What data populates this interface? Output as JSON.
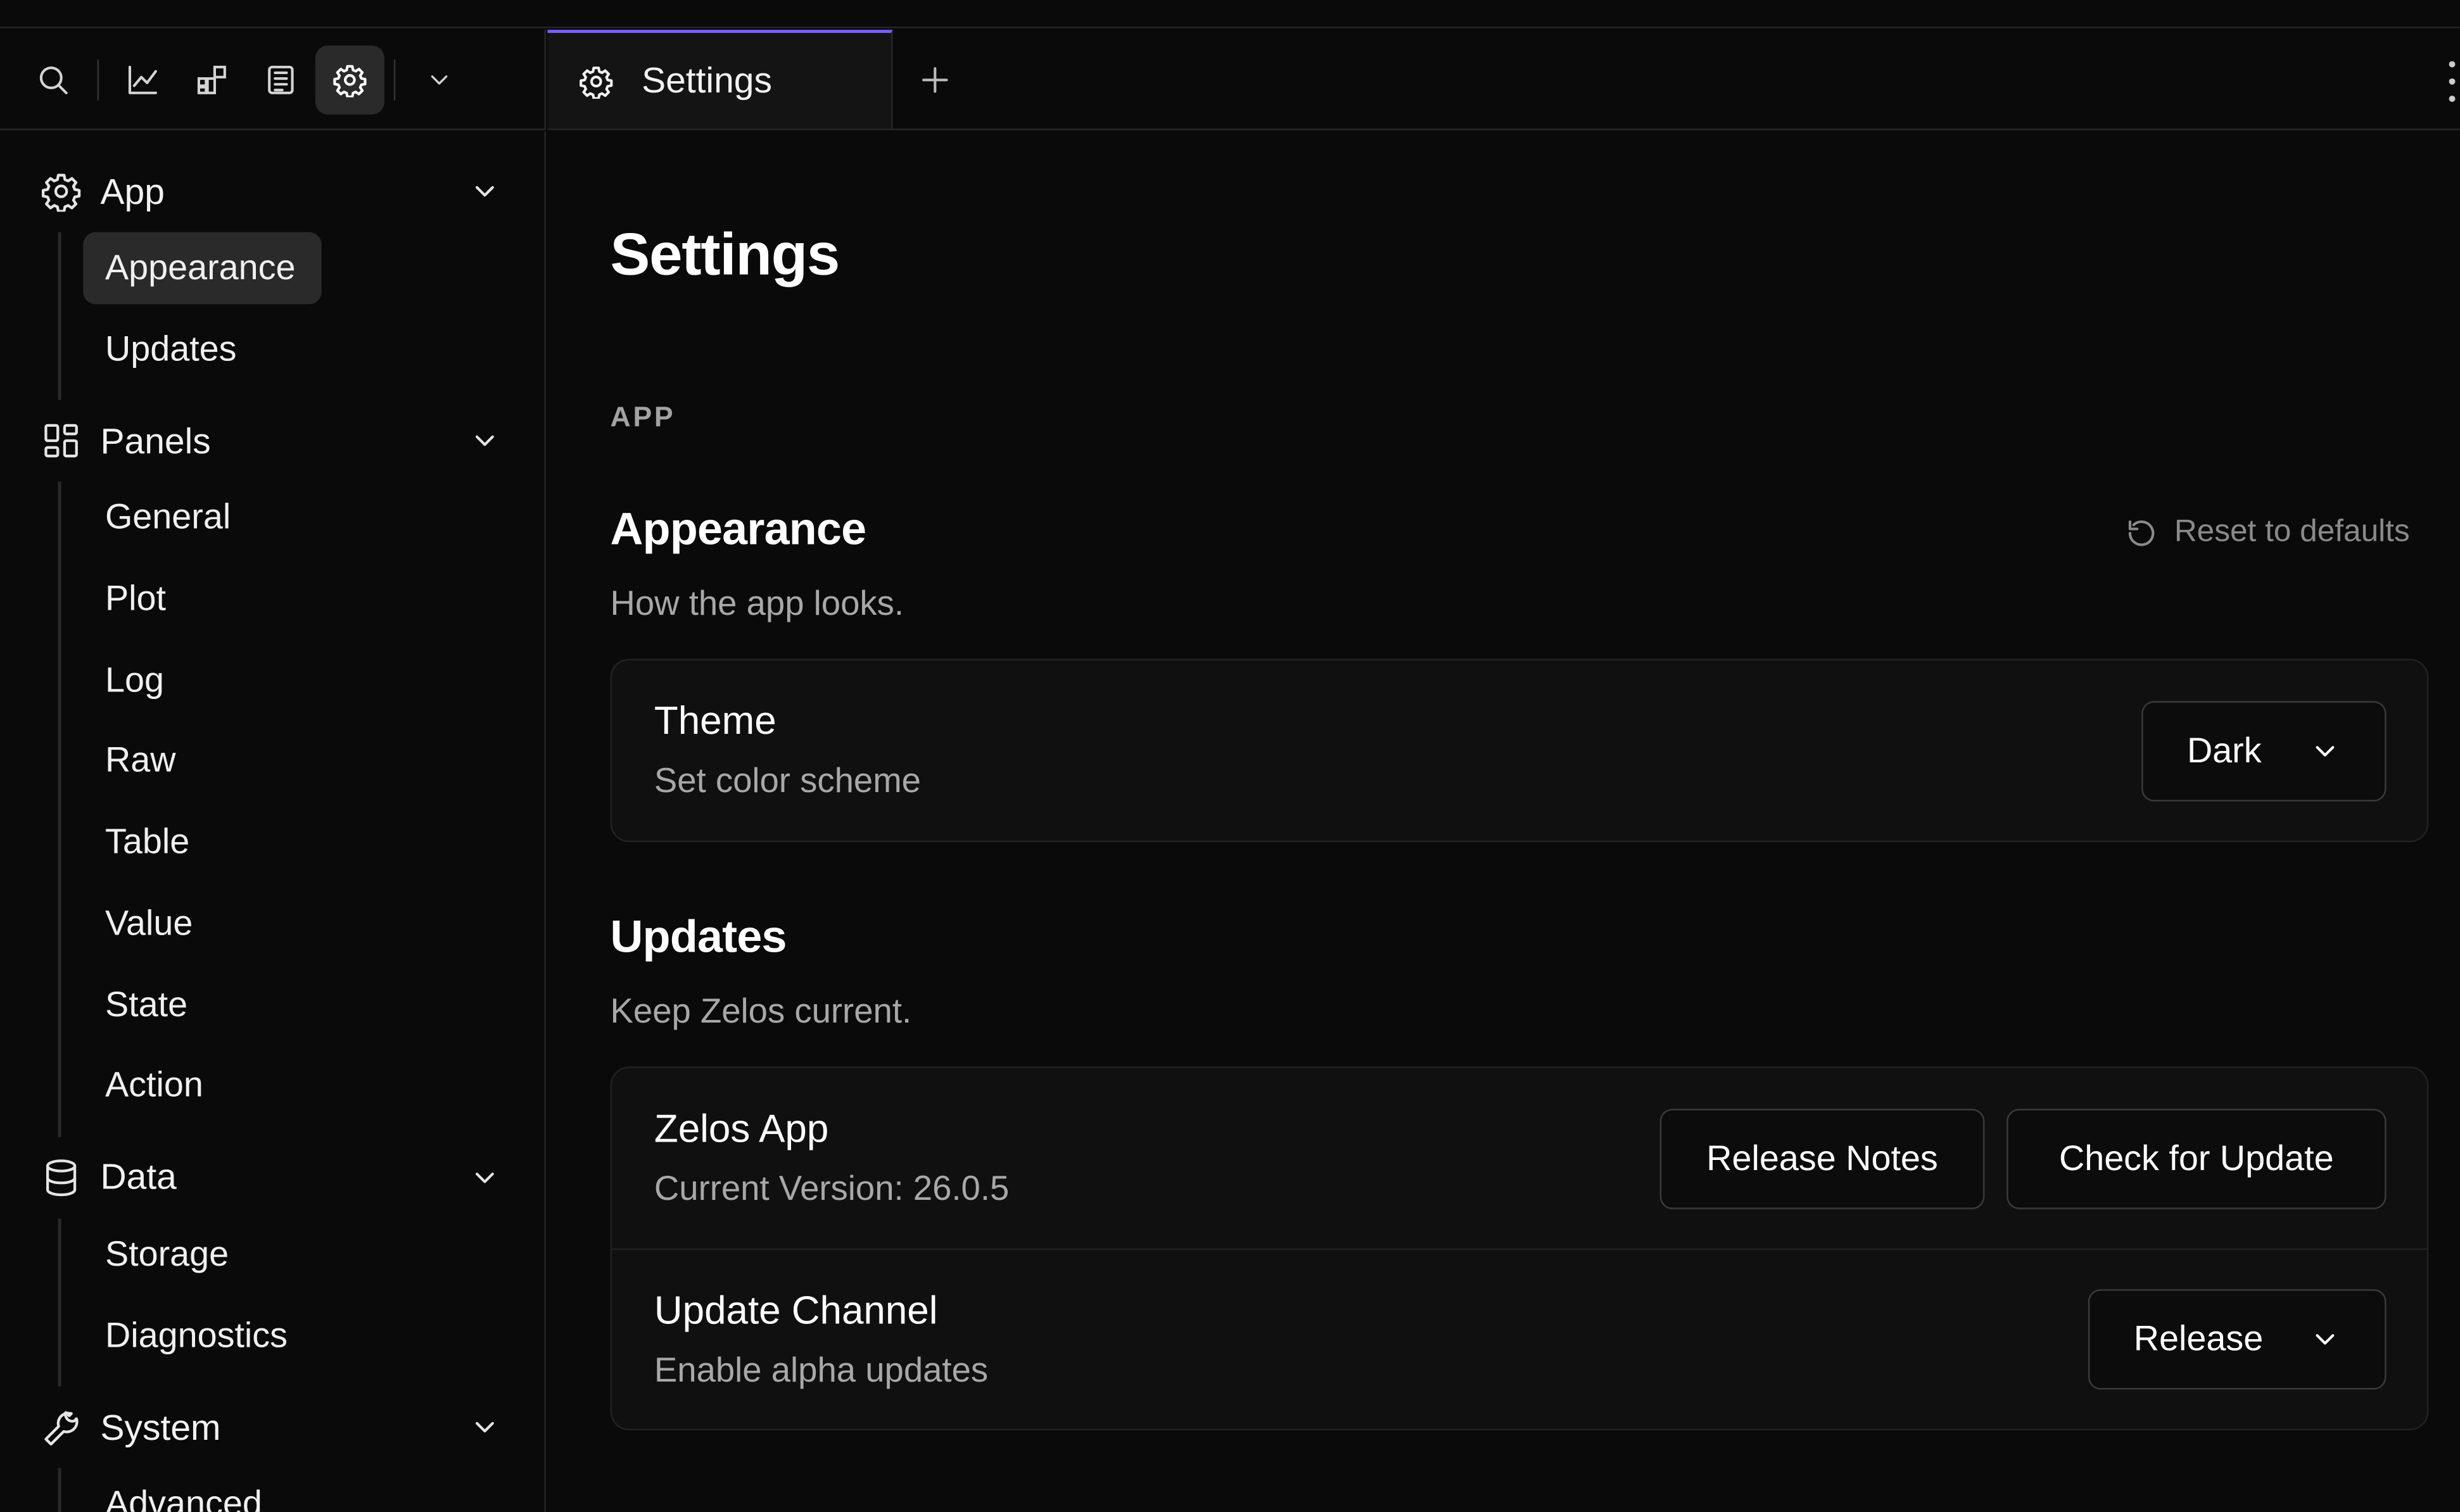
{
  "toolbar": {
    "icons": [
      "search-icon",
      "chart-icon",
      "panels-icon",
      "log-icon",
      "gear-icon",
      "chevron-down-icon"
    ]
  },
  "tabs": [
    {
      "label": "Settings",
      "icon": "gear-icon",
      "active": true
    }
  ],
  "sidebar": {
    "groups": [
      {
        "label": "App",
        "icon": "gear-icon",
        "items": [
          "Appearance",
          "Updates"
        ]
      },
      {
        "label": "Panels",
        "icon": "panels-icon",
        "items": [
          "General",
          "Plot",
          "Log",
          "Raw",
          "Table",
          "Value",
          "State",
          "Action"
        ]
      },
      {
        "label": "Data",
        "icon": "database-icon",
        "items": [
          "Storage",
          "Diagnostics"
        ]
      },
      {
        "label": "System",
        "icon": "wrench-icon",
        "items": [
          "Advanced"
        ]
      }
    ],
    "active_item": "Appearance"
  },
  "main": {
    "title": "Settings",
    "section_label": "APP",
    "appearance": {
      "title": "Appearance",
      "description": "How the app looks.",
      "reset_label": "Reset to defaults",
      "theme": {
        "title": "Theme",
        "subtitle": "Set color scheme",
        "value": "Dark"
      }
    },
    "updates": {
      "title": "Updates",
      "description": "Keep Zelos current.",
      "app": {
        "title": "Zelos App",
        "subtitle": "Current Version: 26.0.5",
        "release_notes_label": "Release Notes",
        "check_label": "Check for Update"
      },
      "channel": {
        "title": "Update Channel",
        "subtitle": "Enable alpha updates",
        "value": "Release"
      }
    }
  },
  "colors": {
    "background": "#0a0a0a",
    "accent": "#7c5cff",
    "active_bg": "#2a2a2a"
  }
}
